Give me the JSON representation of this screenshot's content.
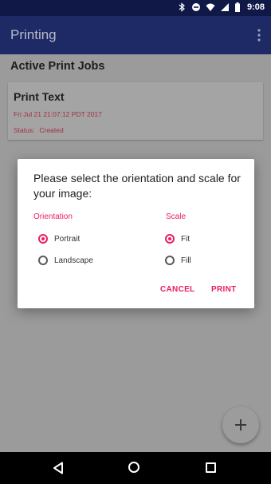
{
  "status_bar": {
    "time": "9:08",
    "icons": [
      "bluetooth-icon",
      "minus-circle-icon",
      "wifi-icon",
      "signal-icon",
      "battery-icon"
    ]
  },
  "app_bar": {
    "title": "Printing",
    "menu_icon": "more-vert-icon"
  },
  "main": {
    "section_title": "Active Print Jobs",
    "job": {
      "title": "Print Text",
      "date": "Fri Jul 21 21:07:12 PDT 2017",
      "status_label": "Status:",
      "status_value": "Created"
    },
    "fab_icon": "plus-icon"
  },
  "dialog": {
    "title": "Please select the orientation and scale for your image:",
    "orientation": {
      "label": "Orientation",
      "options": [
        "Portrait",
        "Landscape"
      ],
      "selected": "Portrait"
    },
    "scale": {
      "label": "Scale",
      "options": [
        "Fit",
        "Fill"
      ],
      "selected": "Fit"
    },
    "cancel_label": "CANCEL",
    "print_label": "PRINT"
  },
  "colors": {
    "accent": "#e91e63",
    "app_bar": "#1e2a66",
    "status_bar": "#101848"
  },
  "nav_bar": {
    "icons": [
      "back-icon",
      "home-icon",
      "recents-icon"
    ]
  }
}
